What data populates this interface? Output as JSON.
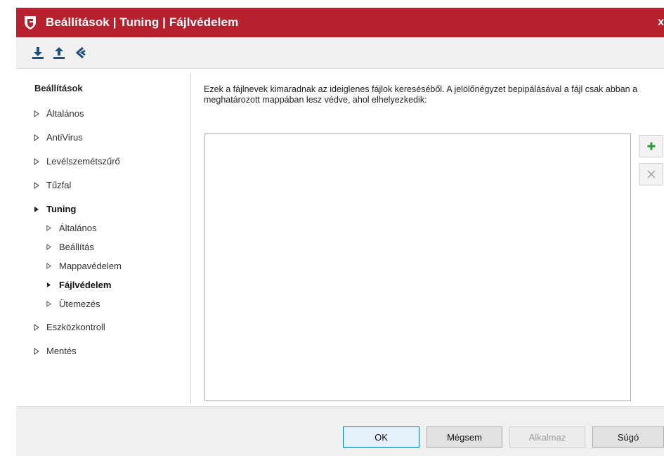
{
  "window": {
    "title": "Beállítások | Tuning | Fájlvédelem",
    "close_glyph": "x"
  },
  "toolbar": {
    "buttons": [
      {
        "icon": "import-download-icon"
      },
      {
        "icon": "export-upload-icon"
      },
      {
        "icon": "reset-defaults-icon"
      }
    ]
  },
  "nav": {
    "heading": "Beállítások",
    "items": [
      {
        "label": "Általános",
        "level": 0,
        "expanded": false
      },
      {
        "label": "AntiVirus",
        "level": 0,
        "expanded": false
      },
      {
        "label": "Levélszemétszűrő",
        "level": 0,
        "expanded": false
      },
      {
        "label": "Tűzfal",
        "level": 0,
        "expanded": false
      },
      {
        "label": "Tuning",
        "level": 0,
        "expanded": true,
        "selected": true
      },
      {
        "label": "Általános",
        "level": 1
      },
      {
        "label": "Beállítás",
        "level": 1
      },
      {
        "label": "Mappavédelem",
        "level": 1
      },
      {
        "label": "Fájlvédelem",
        "level": 1,
        "selected": true
      },
      {
        "label": "Ütemezés",
        "level": 1
      },
      {
        "label": "Eszközkontroll",
        "level": 0,
        "expanded": false
      },
      {
        "label": "Mentés",
        "level": 0,
        "expanded": false
      }
    ]
  },
  "content": {
    "description": "Ezek a fájlnevek kimaradnak az ideiglenes fájlok kereséséből. A jelölőnégyzet bepipálásával a fájl csak abban a meghatározott mappában lesz védve, ahol elhelyezkedik:",
    "list_items": [],
    "add_icon": "plus-icon",
    "remove_icon": "close-icon"
  },
  "footer": {
    "ok_label": "OK",
    "cancel_label": "Mégsem",
    "apply_label": "Alkalmaz",
    "help_label": "Súgó"
  },
  "colors": {
    "titlebar": "#b7212e",
    "toolbar_icons": "#1f4e79",
    "add_green": "#2e9e3a"
  }
}
